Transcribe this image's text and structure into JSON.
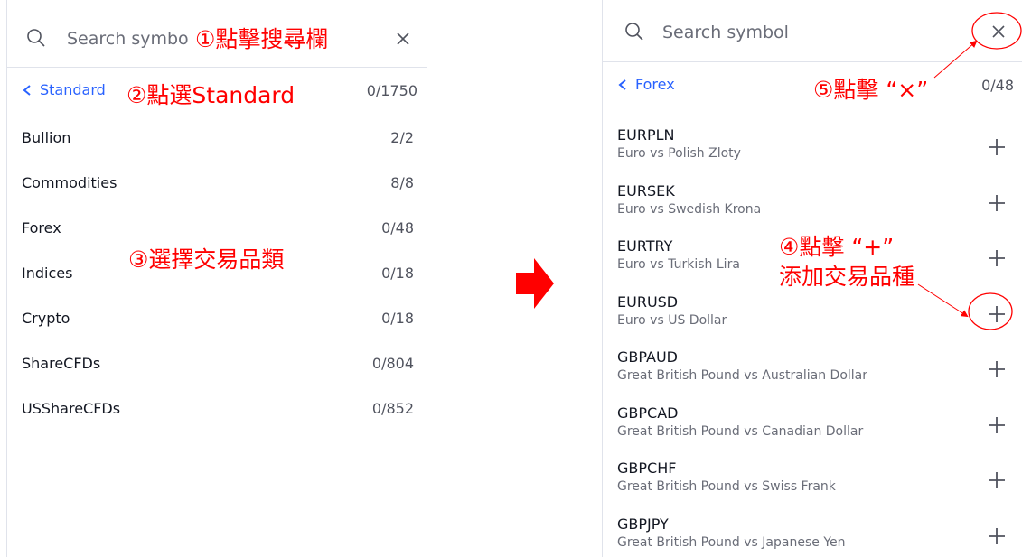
{
  "left": {
    "search_placeholder": "Search symbo",
    "breadcrumb": "Standard",
    "breadcrumb_count": "0/1750",
    "categories": [
      {
        "label": "Bullion",
        "count": "2/2"
      },
      {
        "label": "Commodities",
        "count": "8/8"
      },
      {
        "label": "Forex",
        "count": "0/48"
      },
      {
        "label": "Indices",
        "count": "0/18"
      },
      {
        "label": "Crypto",
        "count": "0/18"
      },
      {
        "label": "ShareCFDs",
        "count": "0/804"
      },
      {
        "label": "USShareCFDs",
        "count": "0/852"
      }
    ]
  },
  "right": {
    "search_placeholder": "Search symbol",
    "breadcrumb": "Forex",
    "breadcrumb_count": "0/48",
    "symbols": [
      {
        "name": "EURPLN",
        "desc": "Euro vs Polish Zloty"
      },
      {
        "name": "EURSEK",
        "desc": "Euro vs Swedish Krona"
      },
      {
        "name": "EURTRY",
        "desc": "Euro vs Turkish Lira"
      },
      {
        "name": "EURUSD",
        "desc": "Euro vs US Dollar"
      },
      {
        "name": "GBPAUD",
        "desc": "Great British Pound vs Australian Dollar"
      },
      {
        "name": "GBPCAD",
        "desc": "Great British Pound vs Canadian Dollar"
      },
      {
        "name": "GBPCHF",
        "desc": "Great British Pound vs Swiss Frank"
      },
      {
        "name": "GBPJPY",
        "desc": "Great British Pound vs Japanese Yen"
      }
    ]
  },
  "annotations": {
    "step1": "①點擊搜尋欄",
    "step2": "②點選Standard",
    "step3": "③選擇交易品類",
    "step4_line1": "④點擊 “+”",
    "step4_line2": "添加交易品種",
    "step5": "⑤點擊 “×”"
  },
  "colors": {
    "accent": "#2962ff",
    "annotation": "#ff0000",
    "border": "#e0e3eb"
  },
  "icons": {
    "search": "search-icon",
    "close": "close-icon",
    "back": "chevron-left-icon",
    "add": "plus-icon",
    "arrow": "right-arrow-icon"
  }
}
